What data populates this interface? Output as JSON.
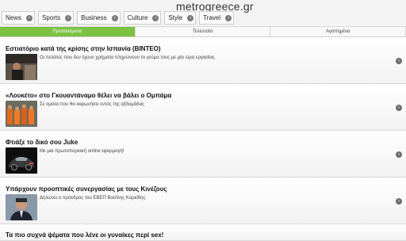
{
  "site": {
    "logo": "metrogreece.gr"
  },
  "nav": [
    {
      "label": "News"
    },
    {
      "label": "Sports"
    },
    {
      "label": "Business"
    },
    {
      "label": "Culture"
    },
    {
      "label": "Style"
    },
    {
      "label": "Travel"
    }
  ],
  "tabs": [
    {
      "label": "Προτεινόμενα",
      "active": true
    },
    {
      "label": "Τελευταία",
      "active": false
    },
    {
      "label": "Αγαπημένα",
      "active": false
    }
  ],
  "articles": [
    {
      "title": "Εστιατόριο κατά της κρίσης στην Ισπανία (ΒΙΝΤΕΟ)",
      "summary": "Οι πελάτες που δεν έχουν χρήματα πληρώνουν το γεύμα τους με μία ώρα εργασίας",
      "thumb_icon": "restaurant-photo"
    },
    {
      "title": "«Λουκέτο» στο Γκουαντάναμο θέλει να βάλει ο Ομπάμα",
      "summary": "Σε ομιλία που θα εκφωνήσει εντός της εβδομάδας",
      "thumb_icon": "prisoners-photo"
    },
    {
      "title": "Φτιάξε το δικό σου Juke",
      "summary": "Με μια πρωτοποριακή online εφαρμογή!",
      "thumb_icon": "car-photo"
    },
    {
      "title": "Υπάρχουν προοπτικές συνεργασίας με τους Κινέζους",
      "summary": "Δηλώνει ο πρόεδρος του ΕΒΕΠ Βασίλης Κορκίδης",
      "thumb_icon": "portrait-photo"
    },
    {
      "title": "Τα πιο συχνά ψέματα που λένε οι γυναίκες περί sex!",
      "summary": "",
      "thumb_icon": ""
    }
  ],
  "colors": {
    "active_tab": "#7cc242",
    "arrow": "#6e6e6e"
  }
}
